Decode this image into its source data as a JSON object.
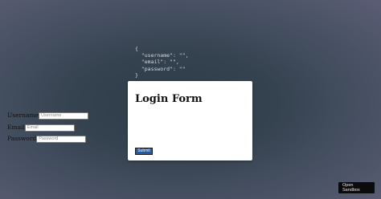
{
  "json_preview": "{\n  \"username\": \"\",\n  \"email\": \"\",\n  \"password\": \"\"\n}",
  "form": {
    "title": "Login Form",
    "fields": [
      {
        "label": "Username",
        "placeholder": "Username",
        "value": ""
      },
      {
        "label": "Email",
        "placeholder": "Email",
        "value": ""
      },
      {
        "label": "Password",
        "placeholder": "Password",
        "value": ""
      }
    ],
    "submit_label": "Submit"
  },
  "sandbox_button": {
    "line1": "Open",
    "line2": "Sandbox"
  },
  "colors": {
    "submit_background": "#1f5aa8",
    "card_background": "#ffffff",
    "sandbox_background": "#0b0b0b"
  }
}
